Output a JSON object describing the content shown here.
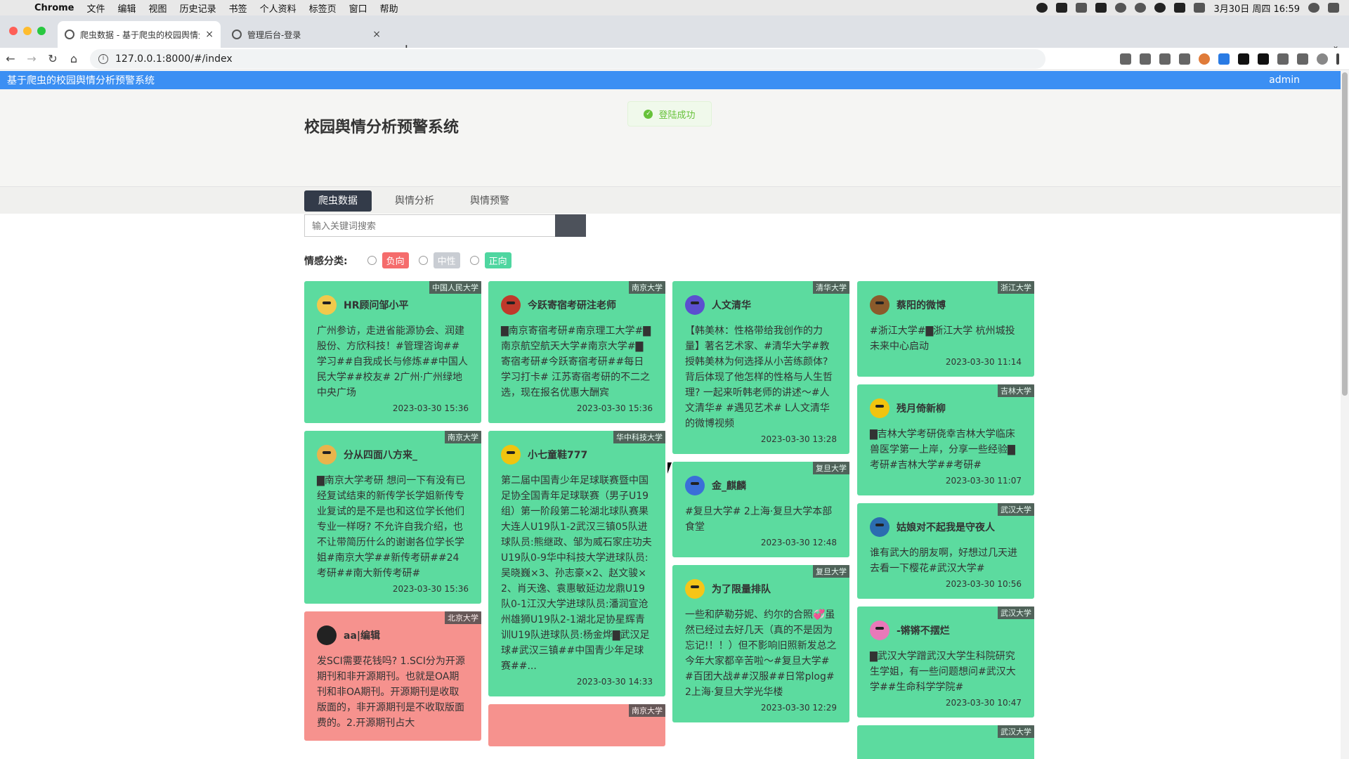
{
  "menubar": {
    "app": "Chrome",
    "items": [
      "文件",
      "编辑",
      "视图",
      "历史记录",
      "书签",
      "个人资料",
      "标签页",
      "窗口",
      "帮助"
    ],
    "clock": "3月30日 周四 16:59"
  },
  "tabs": [
    {
      "title": "爬虫数据 - 基于爬虫的校园舆情分析",
      "close": "×"
    },
    {
      "title": "管理后台-登录",
      "close": "×"
    }
  ],
  "new_tab": "+",
  "url": "127.0.0.1:8000/#/index",
  "system": {
    "title": "基于爬虫的校园舆情分析预警系统",
    "user": "admin"
  },
  "toast": "登陆成功",
  "page_title": "校园舆情分析预警系统",
  "nav": [
    "爬虫数据",
    "舆情分析",
    "舆情预警"
  ],
  "search": {
    "placeholder": "输入关键词搜索"
  },
  "filter": {
    "label": "情感分类:",
    "options": [
      "负向",
      "中性",
      "正向"
    ]
  },
  "colors": {
    "positive": "#5cdb9f",
    "negative": "#f6928e",
    "neutral": "#c9cdd3",
    "neg_tag": "#f56c6c",
    "pos_tag": "#4fd6a0",
    "accent": "#3b8ff3"
  },
  "columns": [
    [
      {
        "school": "中国人民大学",
        "name": "HR顾问邹小平",
        "text": "广州参访，走进省能源协会、润建股份、方欣科技！#管理咨询##学习##自我成长与修炼##中国人民大学##校友# 2广州·广州绿地中央广场",
        "time": "2023-03-30 15:36",
        "sentiment": "pos",
        "avatar": "#f2c94c"
      },
      {
        "school": "南京大学",
        "name": "分从四面八方来_",
        "text": "▇南京大学考研 想问一下有没有已经复试结束的新传学长学姐新传专业复试的是不是也和这位学长他们专业一样呀? 不允许自我介绍，也不让带简历什么的谢谢各位学长学姐#南京大学##新传考研##24考研##南大新传考研#",
        "time": "2023-03-30 15:36",
        "sentiment": "pos",
        "avatar": "#e9b44c"
      },
      {
        "school": "北京大学",
        "name": "aa|编辑",
        "text": "发SCI需要花钱吗? 1.SCI分为开源期刊和非开源期刊。也就是OA期刊和非OA期刊。开源期刊是收取版面的，非开源期刊是不收取版面费的。2.开源期刊占大",
        "time": "",
        "sentiment": "neg",
        "avatar": "#222222"
      }
    ],
    [
      {
        "school": "南京大学",
        "name": "今跃寄宿考研注老师",
        "text": "▇南京寄宿考研#南京理工大学#▇南京航空航天大学#南京大学#▇寄宿考研#今跃寄宿考研##每日学习打卡# 江苏寄宿考研的不二之选，现在报名优惠大酬宾",
        "time": "2023-03-30 15:36",
        "sentiment": "pos",
        "avatar": "#c0392b"
      },
      {
        "school": "华中科技大学",
        "name": "小七童鞋777",
        "text": "第二届中国青少年足球联赛暨中国足协全国青年足球联赛（男子U19组）第一阶段第二轮湖北球队赛果大连人U19队1-2武汉三镇05队进球队员:熊继政、邹为威石家庄功夫U19队0-9华中科技大学进球队员:吴晓巍×3、孙志豪×2、赵文骏×2、肖天逸、袁惠敏延边龙鼎U19队0-1江汉大学进球队员:潘润宣沧州雄狮U19队2-1湖北足协星辉青训U19队进球队员:杨金烨▇武汉足球#武汉三镇##中国青少年足球赛##...",
        "time": "2023-03-30 14:33",
        "sentiment": "pos",
        "avatar": "#f1c40f"
      },
      {
        "school": "南京大学",
        "name": "",
        "text": "",
        "time": "",
        "sentiment": "neg",
        "avatar": "#ccc"
      }
    ],
    [
      {
        "school": "清华大学",
        "name": "人文清华",
        "text": "【韩美林：性格带给我创作的力量】著名艺术家、#清华大学#教授韩美林为何选择从小苦练颜体? 背后体现了他怎样的性格与人生哲理? 一起来听韩老师的讲述～#人文清华# #遇见艺术# L人文清华的微博视频",
        "time": "2023-03-30 13:28",
        "sentiment": "pos",
        "avatar": "#5b4fcf"
      },
      {
        "school": "复旦大学",
        "name": "金_麒麟",
        "text": "#复旦大学# 2上海·复旦大学本部食堂",
        "time": "2023-03-30 12:48",
        "sentiment": "pos",
        "avatar": "#3a6fd8"
      },
      {
        "school": "复旦大学",
        "name": "为了限量排队",
        "text": "一些和萨勒芬妮、约尔的合照💞虽然已经过去好几天（真的不是因为忘记!！！）但不影响旧照新发总之今年大家都辛苦啦～#复旦大学##百团大战##汉服##日常plog# 2上海·复旦大学光华楼",
        "time": "2023-03-30 12:29",
        "sentiment": "pos",
        "avatar": "#f5c518"
      }
    ],
    [
      {
        "school": "浙江大学",
        "name": "蔡阳的微博",
        "text": "#浙江大学#▇浙江大学 杭州城投未来中心启动",
        "time": "2023-03-30 11:14",
        "sentiment": "pos",
        "avatar": "#8b5a2b"
      },
      {
        "school": "吉林大学",
        "name": "残月倚新柳",
        "text": "▇吉林大学考研侥幸吉林大学临床兽医学第一上岸，分享一些经验▇考研#吉林大学##考研#",
        "time": "2023-03-30 11:07",
        "sentiment": "pos",
        "avatar": "#f1c40f"
      },
      {
        "school": "武汉大学",
        "name": "姑娘对不起我是守夜人",
        "text": "谁有武大的朋友啊，好想过几天进去看一下樱花#武汉大学#",
        "time": "2023-03-30 10:56",
        "sentiment": "pos",
        "avatar": "#2b6cb0"
      },
      {
        "school": "武汉大学",
        "name": "-锵锵不摆烂",
        "text": "▇武汉大学蹭武汉大学生科院研究生学姐，有一些问题想问#武汉大学##生命科学学院#",
        "time": "2023-03-30 10:47",
        "sentiment": "pos",
        "avatar": "#e879b9"
      },
      {
        "school": "武汉大学",
        "name": "",
        "text": "",
        "time": "",
        "sentiment": "pos",
        "avatar": "#ccc"
      }
    ]
  ]
}
